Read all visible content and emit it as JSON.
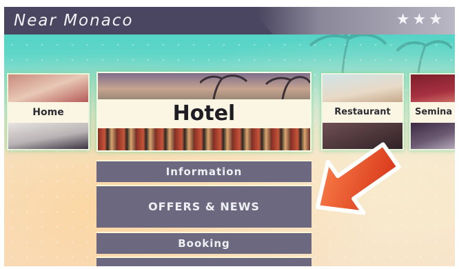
{
  "header": {
    "title": "Near Monaco",
    "rating": "★★★"
  },
  "tiles": {
    "home": "Home",
    "hotel": "Hotel",
    "restaurant": "Restaurant",
    "seminars": "Semina"
  },
  "menu": [
    {
      "label": "Information"
    },
    {
      "label": "OFFERS & NEWS"
    },
    {
      "label": "Booking"
    }
  ],
  "colors": {
    "titlebar": "#4a4560",
    "menu_bg": "#6c6880",
    "accent_arrow": "#e8401c",
    "sea": "#44cfc4"
  },
  "icons": [
    "star-icon",
    "arrow-pointer-icon"
  ]
}
